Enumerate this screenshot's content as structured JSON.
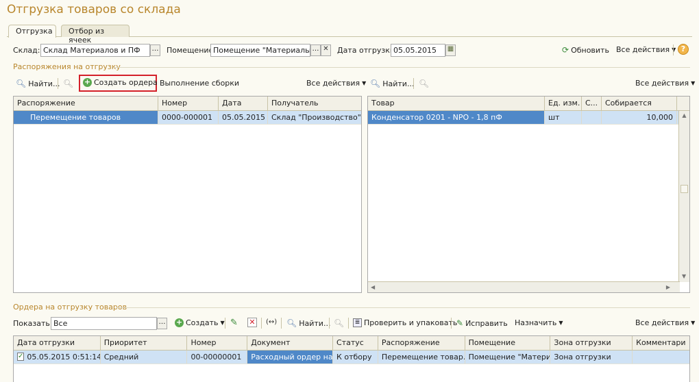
{
  "window": {
    "title": "Отгрузка товаров со склада"
  },
  "tabs": [
    {
      "label": "Отгрузка"
    },
    {
      "label": "Отбор из ячеек"
    }
  ],
  "filters": {
    "warehouse_label": "Склад:",
    "warehouse_value": "Склад Материалов и ПФ",
    "room_label": "Помещение:",
    "room_value": "Помещение \"Материалы\"",
    "date_label": "Дата отгрузки:",
    "date_value": "05.05.2015",
    "refresh_label": "Обновить",
    "all_actions_label": "Все действия",
    "help_label": "?"
  },
  "orders_section": {
    "title": "Распоряжения на отгрузку",
    "toolbar": {
      "find_label": "Найти...",
      "create_orders_label": "Создать ордера",
      "assembly_label": "Выполнение сборки",
      "all_actions_label": "Все действия"
    },
    "columns": [
      "Распоряжение",
      "Номер",
      "Дата",
      "Получатель"
    ],
    "rows": [
      {
        "doc": "Перемещение товаров",
        "number": "0000-000001",
        "date": "05.05.2015",
        "recipient": "Склад \"Производство\""
      }
    ]
  },
  "goods_section": {
    "toolbar": {
      "find_label": "Найти...",
      "all_actions_label": "Все действия"
    },
    "columns": [
      "Товар",
      "Ед. изм.",
      "С...",
      "Собирается"
    ],
    "rows": [
      {
        "item": "Конденсатор 0201 - NPO - 1,8 пФ",
        "unit": "шт",
        "s": "",
        "collecting": "10,000"
      }
    ]
  },
  "shipments_section": {
    "title": "Ордера на отгрузку товаров",
    "toolbar": {
      "show_label": "Показать:",
      "show_value": "Все",
      "create_label": "Создать",
      "find_label": "Найти...",
      "check_pack_label": "Проверить и упаковать",
      "fix_label": "Исправить",
      "assign_label": "Назначить",
      "all_actions_label": "Все действия"
    },
    "columns": [
      "Дата отгрузки",
      "Приоритет",
      "Номер",
      "Документ",
      "Статус",
      "Распоряжение",
      "Помещение",
      "Зона отгрузки",
      "Комментари"
    ],
    "rows": [
      {
        "date": "05.05.2015 0:51:14",
        "priority": "Средний",
        "number": "00-00000001",
        "document": "Расходный ордер на ...",
        "status": "К отбору",
        "order": "Перемещение товар...",
        "room": "Помещение \"Матери...",
        "zone": "Зона отгрузки",
        "comment": ""
      }
    ]
  },
  "colors": {
    "title": "#b8862c",
    "selection": "#4f88c8",
    "highlight_border": "#d4202a"
  }
}
